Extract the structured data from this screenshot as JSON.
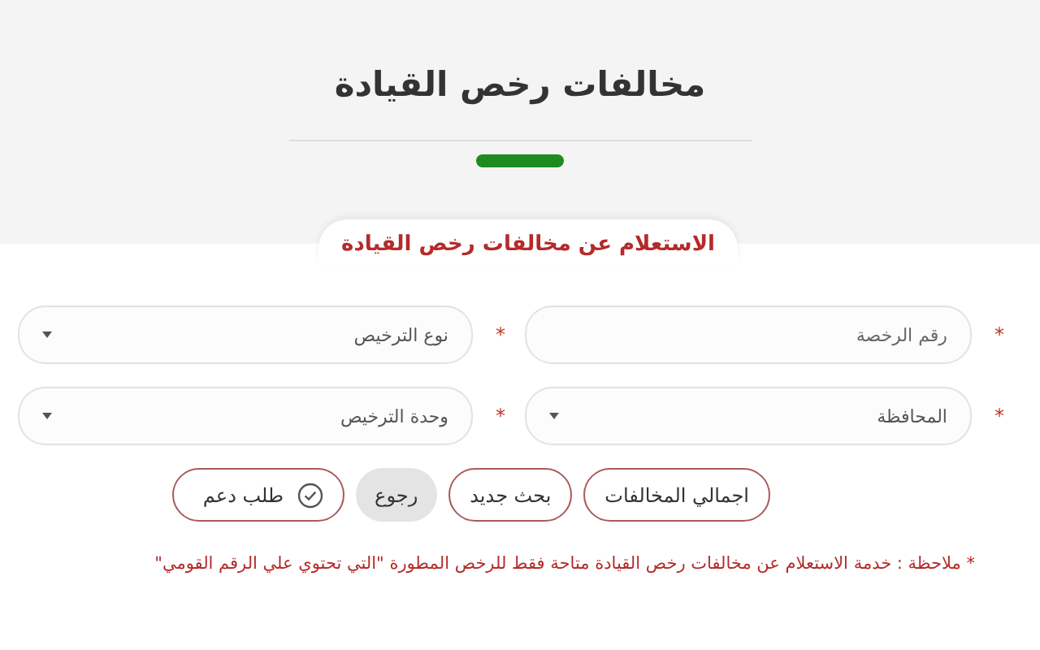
{
  "header": {
    "title": "مخالفات رخص القيادة"
  },
  "form_tab": {
    "label": "الاستعلام عن مخالفات رخص القيادة"
  },
  "fields": [
    {
      "kind": "input",
      "placeholder": "رقم الرخصة",
      "required_mark": "*"
    },
    {
      "kind": "select",
      "placeholder": "نوع الترخيص",
      "required_mark": "*"
    },
    {
      "kind": "select",
      "placeholder": "المحافظة",
      "required_mark": "*"
    },
    {
      "kind": "select",
      "placeholder": "وحدة الترخيص",
      "required_mark": "*"
    }
  ],
  "buttons": [
    {
      "kind": "outline",
      "label": "اجمالي المخالفات"
    },
    {
      "kind": "outline",
      "label": "بحث جديد"
    },
    {
      "kind": "muted",
      "label": "رجوع"
    },
    {
      "kind": "support",
      "label": "طلب دعم"
    }
  ],
  "note": "* ملاحظة : خدمة الاستعلام عن مخالفات رخص القيادة متاحة فقط للرخص المطورة \"التي تحتوي علي الرقم القومي\""
}
